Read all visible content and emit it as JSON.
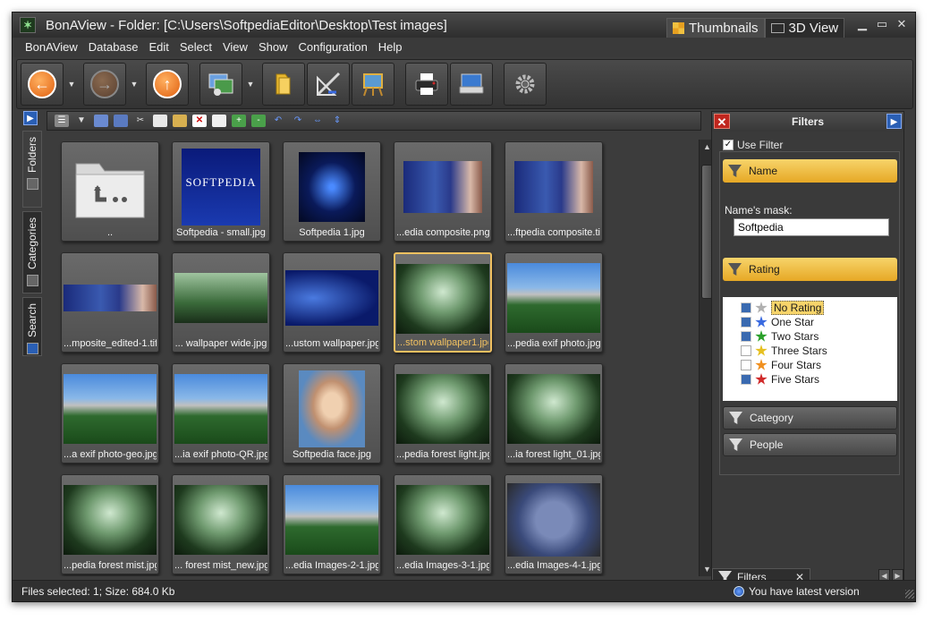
{
  "window": {
    "title": "BonAView - Folder: [C:\\Users\\SoftpediaEditor\\Desktop\\Test images]",
    "view_tabs": [
      {
        "label": "Thumbnails",
        "icon": "thumbnails-grid-icon",
        "active": true
      },
      {
        "label": "3D View",
        "icon": "3d-view-icon",
        "active": false
      }
    ],
    "controls": {
      "minimize": "▭",
      "maximize": "□",
      "close": "✕"
    }
  },
  "menu": [
    "BonAView",
    "Database",
    "Edit",
    "Select",
    "View",
    "Show",
    "Configuration",
    "Help"
  ],
  "toolbar": {
    "buttons": [
      "back",
      "forward",
      "up",
      "wallpaper",
      "folder",
      "edit-image",
      "slideshow",
      "print",
      "scan",
      "settings"
    ],
    "back_glyph": "←",
    "forward_glyph": "→",
    "up_glyph": "↑"
  },
  "side_tabs": [
    {
      "label": "Folders",
      "icon": "folders-icon"
    },
    {
      "label": "Categories",
      "icon": "categories-icon"
    },
    {
      "label": "Search",
      "icon": "search-icon"
    }
  ],
  "thumbnails": [
    {
      "label": "..",
      "style": "parent"
    },
    {
      "label": "Softpedia  - small.jpg",
      "style": "softpedia-small",
      "text": "SOFTPEDIA"
    },
    {
      "label": "Softpedia 1.jpg",
      "style": "swirl"
    },
    {
      "label": "...edia composite.png",
      "style": "composite"
    },
    {
      "label": "...ftpedia composite.tif",
      "style": "composite"
    },
    {
      "label": "...mposite_edited-1.tif",
      "style": "composite-wide"
    },
    {
      "label": "... wallpaper wide.jpg",
      "style": "forest-wide"
    },
    {
      "label": "...ustom wallpaper.jpg",
      "style": "blue-wide"
    },
    {
      "label": "...stom wallpaper1.jpg",
      "style": "forest",
      "selected": true
    },
    {
      "label": "...pedia exif photo.jpg",
      "style": "mountain"
    },
    {
      "label": "...a exif photo-geo.jpg",
      "style": "mountain"
    },
    {
      "label": "...ia exif photo-QR.jpg",
      "style": "mountain"
    },
    {
      "label": "Softpedia face.jpg",
      "style": "face"
    },
    {
      "label": "...pedia forest light.jpg",
      "style": "forest"
    },
    {
      "label": "...ia forest light_01.jpg",
      "style": "forest"
    },
    {
      "label": "...pedia forest mist.jpg",
      "style": "forest"
    },
    {
      "label": "... forest mist_new.jpg",
      "style": "forest"
    },
    {
      "label": "...edia Images-2-1.jpg",
      "style": "mountain"
    },
    {
      "label": "...edia Images-3-1.jpg",
      "style": "forest"
    },
    {
      "label": "...edia Images-4-1.jpg",
      "style": "badge"
    }
  ],
  "filters": {
    "title": "Filters",
    "use_filter_label": "Use Filter",
    "use_filter_checked": true,
    "name_section": "Name",
    "name_mask_label": "Name's mask:",
    "name_mask_value": "Softpedia",
    "rating_section": "Rating",
    "ratings": [
      {
        "label": "No Rating",
        "checked": true,
        "star_color": "#b0b0b0",
        "star_text": "0",
        "selected": true
      },
      {
        "label": "One Star",
        "checked": true,
        "star_color": "#3a6ae0",
        "star_text": "1"
      },
      {
        "label": "Two Stars",
        "checked": true,
        "star_color": "#2aa02a",
        "star_text": "2"
      },
      {
        "label": "Three Stars",
        "checked": false,
        "star_color": "#e6c020",
        "star_text": "3"
      },
      {
        "label": "Four Stars",
        "checked": false,
        "star_color": "#f09020",
        "star_text": "4"
      },
      {
        "label": "Five Stars",
        "checked": true,
        "star_color": "#d02a2a",
        "star_text": "5"
      }
    ],
    "category_section": "Category",
    "people_section": "People",
    "bottom_tab_label": "Filters"
  },
  "status": {
    "left": "Files selected: 1; Size: 684.0 Kb",
    "right": "You have latest version"
  }
}
